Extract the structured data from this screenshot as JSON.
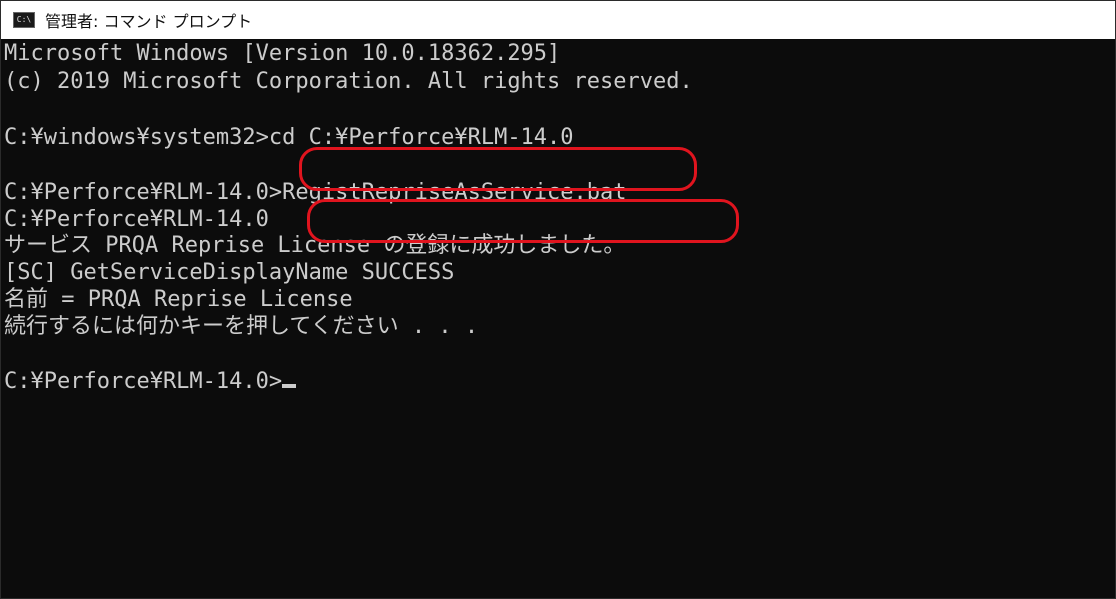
{
  "window": {
    "title": "管理者: コマンド プロンプト",
    "icon": "cmd-icon",
    "icon_text": "C:\\"
  },
  "console": {
    "lines": [
      "Microsoft Windows [Version 10.0.18362.295]",
      "(c) 2019 Microsoft Corporation. All rights reserved.",
      "",
      "C:¥windows¥system32>cd C:¥Perforce¥RLM-14.0",
      "",
      "C:¥Perforce¥RLM-14.0>RegistRepriseAsService.bat",
      "C:¥Perforce¥RLM-14.0",
      "サービス PRQA Reprise License の登録に成功しました。",
      "[SC] GetServiceDisplayName SUCCESS",
      "名前 = PRQA Reprise License",
      "続行するには何かキーを押してください . . .",
      "",
      "C:¥Perforce¥RLM-14.0>"
    ]
  },
  "colors": {
    "console_bg": "#0c0c0c",
    "console_text": "#cccccc",
    "highlight": "#e0141e",
    "titlebar_bg": "#ffffff"
  }
}
